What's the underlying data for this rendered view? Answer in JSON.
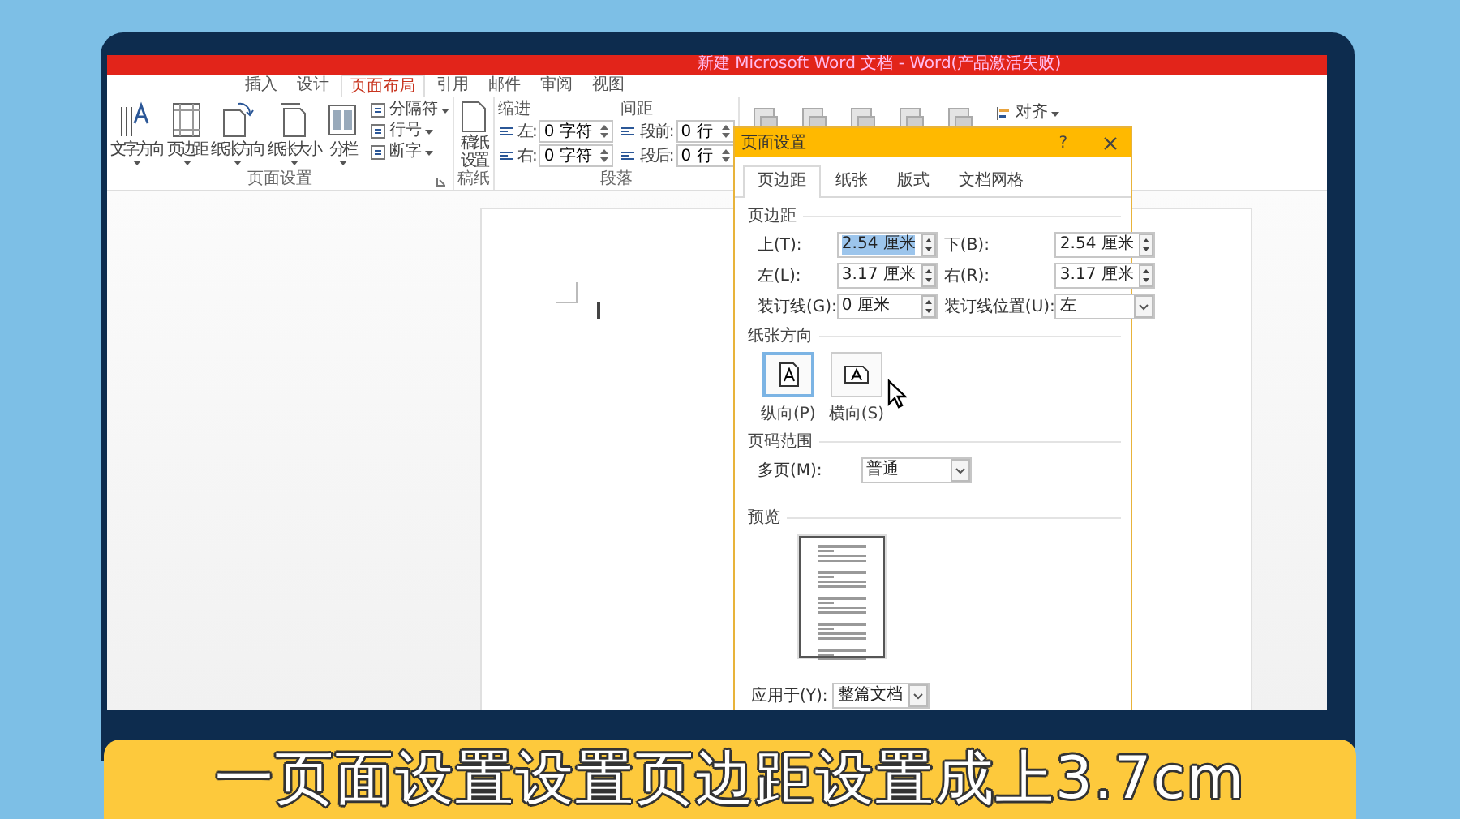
{
  "window": {
    "title": "新建 Microsoft Word 文档 - Word(产品激活失败)"
  },
  "ribbon_tabs": [
    {
      "label": "插入",
      "selected": false
    },
    {
      "label": "设计",
      "selected": false
    },
    {
      "label": "页面布局",
      "selected": true
    },
    {
      "label": "引用",
      "selected": false
    },
    {
      "label": "邮件",
      "selected": false
    },
    {
      "label": "审阅",
      "selected": false
    },
    {
      "label": "视图",
      "selected": false
    }
  ],
  "page_setup_group": {
    "label": "页面设置",
    "large_buttons": [
      "文字方向",
      "页边距",
      "纸张方向",
      "纸张大小",
      "分栏"
    ],
    "small_buttons": [
      "分隔符",
      "行号",
      "断字"
    ]
  },
  "draft_group": {
    "label": "稿纸",
    "button": "稿纸设置"
  },
  "paragraph_group": {
    "label": "段落",
    "indent_heading": "缩进",
    "spacing_heading": "间距",
    "indent_fields": [
      {
        "label": "左:",
        "value": "0 字符"
      },
      {
        "label": "右:",
        "value": "0 字符"
      }
    ],
    "spacing_fields": [
      {
        "label": "段前:",
        "value": "0 行"
      },
      {
        "label": "段后:",
        "value": "0 行"
      }
    ]
  },
  "arrange_group": {
    "buttons": [
      "对齐"
    ]
  },
  "dialog": {
    "title": "页面设置",
    "help": "?",
    "tabs": [
      {
        "label": "页边距",
        "selected": true
      },
      {
        "label": "纸张",
        "selected": false
      },
      {
        "label": "版式",
        "selected": false
      },
      {
        "label": "文档网格",
        "selected": false
      }
    ],
    "margins_heading": "页边距",
    "margin_fields": [
      {
        "kind": "spin",
        "label": "上(T):",
        "value": "2.54 厘米",
        "highlighted": true
      },
      {
        "kind": "spin",
        "label": "下(B):",
        "value": "2.54 厘米",
        "highlighted": false
      },
      {
        "kind": "spin",
        "label": "左(L):",
        "value": "3.17 厘米",
        "highlighted": false
      },
      {
        "kind": "spin",
        "label": "右(R):",
        "value": "3.17 厘米",
        "highlighted": false
      },
      {
        "kind": "spin",
        "label": "装订线(G):",
        "value": "0 厘米",
        "highlighted": false
      },
      {
        "kind": "dropdown",
        "label": "装订线位置(U):",
        "value": "左",
        "highlighted": false
      }
    ],
    "orientation_heading": "纸张方向",
    "orientations": [
      {
        "label": "纵向(P)",
        "selected": true
      },
      {
        "label": "横向(S)",
        "selected": false
      }
    ],
    "pages_heading": "页码范围",
    "pages_field": {
      "label": "多页(M):",
      "value": "普通"
    },
    "preview_heading": "预览",
    "apply_field": {
      "label": "应用于(Y):",
      "value": "整篇文档"
    }
  },
  "caption": "一页面设置设置页边距设置成上3.7cm"
}
